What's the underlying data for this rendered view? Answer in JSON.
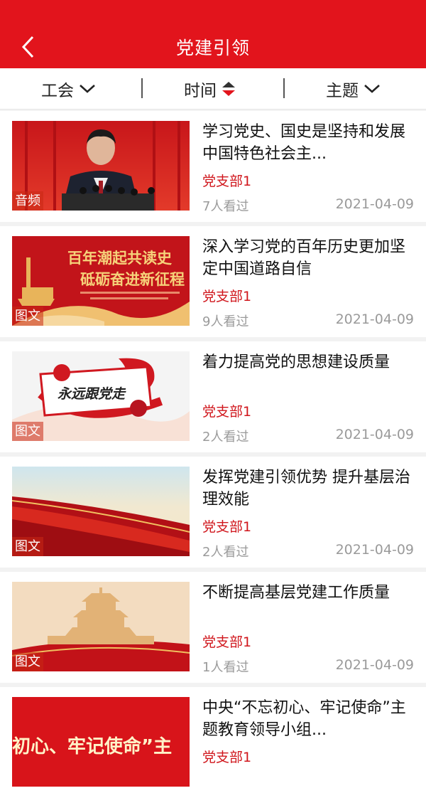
{
  "header": {
    "title": "党建引领",
    "back_icon": "chevron-left-icon"
  },
  "filters": [
    {
      "label": "工会",
      "icon": "chevron-down-icon"
    },
    {
      "label": "时间",
      "icon": "sort-icon"
    },
    {
      "label": "主题",
      "icon": "chevron-down-icon"
    }
  ],
  "colors": {
    "brand_red": "#e2141c",
    "branch_red": "#d0161c"
  },
  "articles": [
    {
      "title": "学习党史、国史是坚持和发展中国特色社会主...",
      "type": "音频",
      "branch": "党支部1",
      "views": "7人看过",
      "date": "2021-04-09"
    },
    {
      "title": "深入学习党的百年历史更加坚定中国道路自信",
      "type": "图文",
      "branch": "党支部1",
      "views": "9人看过",
      "date": "2021-04-09",
      "image_text": [
        "百年潮起共读史",
        "砥砺奋进新征程"
      ]
    },
    {
      "title": "着力提高党的思想建设质量",
      "type": "图文",
      "branch": "党支部1",
      "views": "2人看过",
      "date": "2021-04-09",
      "image_text": [
        "永远跟党走"
      ]
    },
    {
      "title": "发挥党建引领优势 提升基层治理效能",
      "type": "图文",
      "branch": "党支部1",
      "views": "2人看过",
      "date": "2021-04-09"
    },
    {
      "title": "不断提高基层党建工作质量",
      "type": "图文",
      "branch": "党支部1",
      "views": "1人看过",
      "date": "2021-04-09"
    },
    {
      "title": "中央“不忘初心、牢记使命”主题教育领导小组...",
      "type": "",
      "branch": "党支部1",
      "views": "",
      "date": "",
      "image_text": [
        "初心、牢记使命”主"
      ]
    }
  ]
}
